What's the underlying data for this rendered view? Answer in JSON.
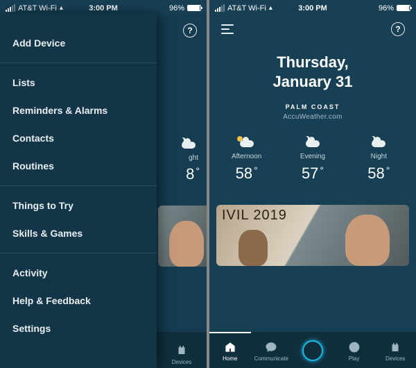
{
  "status": {
    "carrier": "AT&T Wi-Fi",
    "wifi_glyph": "▲",
    "time": "3:00 PM",
    "battery_pct": "96%"
  },
  "date": {
    "line1": "Thursday,",
    "line2": "January 31"
  },
  "location": "PALM COAST",
  "source": "AccuWeather.com",
  "weather": [
    {
      "label": "Afternoon",
      "temp": "58",
      "icon": "sun-cloud"
    },
    {
      "label": "Evening",
      "temp": "57",
      "icon": "moon-cloud"
    },
    {
      "label": "Night",
      "temp": "58",
      "icon": "moon-cloud"
    }
  ],
  "card_text": "IVIL 2019",
  "drawer": [
    [
      "Add Device"
    ],
    [
      "Lists",
      "Reminders & Alarms",
      "Contacts",
      "Routines"
    ],
    [
      "Things to Try",
      "Skills & Games"
    ],
    [
      "Activity",
      "Help & Feedback",
      "Settings"
    ]
  ],
  "peek": {
    "label": "ght",
    "temp": "8"
  },
  "nav": [
    {
      "label": "Home",
      "icon": "home",
      "active": true
    },
    {
      "label": "Communicate",
      "icon": "chat",
      "active": false
    },
    {
      "label": "",
      "icon": "alexa",
      "active": false
    },
    {
      "label": "Play",
      "icon": "play",
      "active": false
    },
    {
      "label": "Devices",
      "icon": "devices",
      "active": false
    }
  ]
}
